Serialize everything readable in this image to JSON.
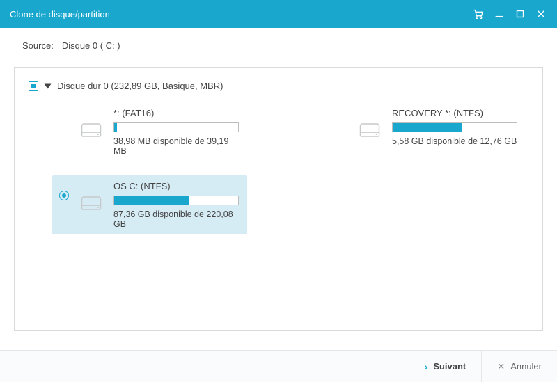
{
  "window": {
    "title": "Clone de disque/partition"
  },
  "source": {
    "label": "Source:",
    "value": "Disque 0 ( C: )"
  },
  "group": {
    "title": "Disque dur 0 (232,89 GB, Basique, MBR)"
  },
  "partitions": [
    {
      "title": "*: (FAT16)",
      "subtitle": "38,98 MB disponible de 39,19 MB",
      "fill_pct": 2,
      "selected": false
    },
    {
      "title": "RECOVERY *: (NTFS)",
      "subtitle": "5,58 GB disponible de 12,76 GB",
      "fill_pct": 56,
      "selected": false
    },
    {
      "title": "OS C: (NTFS)",
      "subtitle": "87,36 GB disponible de 220,08 GB",
      "fill_pct": 60,
      "selected": true
    }
  ],
  "footer": {
    "next": "Suivant",
    "cancel": "Annuler"
  }
}
